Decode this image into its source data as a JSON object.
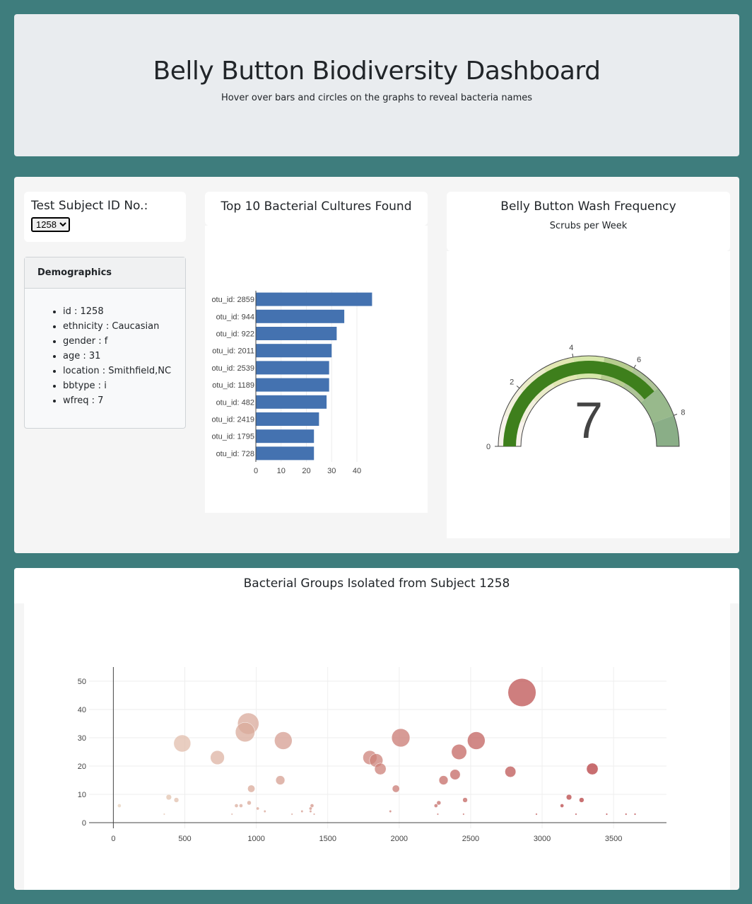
{
  "header": {
    "title": "Belly Button Biodiversity Dashboard",
    "subtitle": "Hover over bars and circles on the graphs to reveal bacteria names"
  },
  "selector": {
    "label": "Test Subject ID No.:",
    "selected": "1258"
  },
  "demographics": {
    "title": "Demographics",
    "items": [
      "id : 1258",
      "ethnicity : Caucasian",
      "gender : f",
      "age : 31",
      "location : Smithfield,NC",
      "bbtype : i",
      "wfreq : 7"
    ]
  },
  "bar_panel": {
    "title": "Top 10 Bacterial Cultures Found"
  },
  "gauge_panel": {
    "title": "Belly Button Wash Frequency",
    "subtitle": "Scrubs per Week",
    "value_text": "7"
  },
  "bubble_panel": {
    "title": "Bacterial Groups Isolated from Subject 1258"
  },
  "colors": {
    "bar": "#4472b0",
    "gauge_bar": "#3e7f1c",
    "page_bg": "#3e7d7d"
  },
  "chart_data": [
    {
      "type": "bar",
      "orientation": "horizontal",
      "categories": [
        "otu_id: 2859",
        "otu_id: 944",
        "otu_id: 922",
        "otu_id: 2011",
        "otu_id: 2539",
        "otu_id: 1189",
        "otu_id: 482",
        "otu_id: 2419",
        "otu_id: 1795",
        "otu_id: 728"
      ],
      "values": [
        46,
        35,
        32,
        30,
        29,
        29,
        28,
        25,
        23,
        23
      ],
      "xticks": [
        0,
        10,
        20,
        30,
        40
      ],
      "xlim": [
        0,
        47
      ]
    },
    {
      "type": "gauge",
      "value": 7,
      "range": [
        0,
        9
      ],
      "ticks": [
        0,
        2,
        4,
        6,
        8
      ],
      "steps": [
        {
          "range": [
            0,
            1
          ],
          "color": "#f8f3ec"
        },
        {
          "range": [
            1,
            2
          ],
          "color": "#f2f0dd"
        },
        {
          "range": [
            2,
            3
          ],
          "color": "#eaebc9"
        },
        {
          "range": [
            3,
            4
          ],
          "color": "#e2e7b3"
        },
        {
          "range": [
            4,
            5
          ],
          "color": "#d6e7aa"
        },
        {
          "range": [
            5,
            6
          ],
          "color": "#b7cd8f"
        },
        {
          "range": [
            6,
            7
          ],
          "color": "#aec497"
        },
        {
          "range": [
            7,
            8
          ],
          "color": "#98b98c"
        },
        {
          "range": [
            8,
            9
          ],
          "color": "#8aae87"
        }
      ]
    },
    {
      "type": "scatter",
      "xticks": [
        0,
        500,
        1000,
        1500,
        2000,
        2500,
        3000,
        3500
      ],
      "yticks": [
        0,
        10,
        20,
        30,
        40,
        50
      ],
      "xlim": [
        -170,
        3870
      ],
      "ylim": [
        -2,
        55
      ],
      "points": [
        {
          "x": 2859,
          "y": 46
        },
        {
          "x": 944,
          "y": 35
        },
        {
          "x": 922,
          "y": 32
        },
        {
          "x": 2011,
          "y": 30
        },
        {
          "x": 2539,
          "y": 29
        },
        {
          "x": 1189,
          "y": 29
        },
        {
          "x": 482,
          "y": 28
        },
        {
          "x": 2419,
          "y": 25
        },
        {
          "x": 1795,
          "y": 23
        },
        {
          "x": 728,
          "y": 23
        },
        {
          "x": 1839,
          "y": 22
        },
        {
          "x": 1868,
          "y": 19
        },
        {
          "x": 3351,
          "y": 19
        },
        {
          "x": 2778,
          "y": 18
        },
        {
          "x": 2391,
          "y": 17
        },
        {
          "x": 1168,
          "y": 15
        },
        {
          "x": 2310,
          "y": 15
        },
        {
          "x": 965,
          "y": 12
        },
        {
          "x": 1977,
          "y": 12
        },
        {
          "x": 3188,
          "y": 9
        },
        {
          "x": 388,
          "y": 9
        },
        {
          "x": 441,
          "y": 8
        },
        {
          "x": 2461,
          "y": 8
        },
        {
          "x": 3276,
          "y": 8
        },
        {
          "x": 2277,
          "y": 7
        },
        {
          "x": 950,
          "y": 7
        },
        {
          "x": 893,
          "y": 6
        },
        {
          "x": 861,
          "y": 6
        },
        {
          "x": 2257,
          "y": 6
        },
        {
          "x": 3139,
          "y": 6
        },
        {
          "x": 42,
          "y": 6
        },
        {
          "x": 1390,
          "y": 6
        },
        {
          "x": 1010,
          "y": 5
        },
        {
          "x": 1380,
          "y": 5
        },
        {
          "x": 1060,
          "y": 4
        },
        {
          "x": 1320,
          "y": 4
        },
        {
          "x": 1380,
          "y": 4
        },
        {
          "x": 1938,
          "y": 4
        },
        {
          "x": 1405,
          "y": 3
        },
        {
          "x": 2960,
          "y": 3
        },
        {
          "x": 3237,
          "y": 3
        },
        {
          "x": 3452,
          "y": 3
        },
        {
          "x": 3587,
          "y": 3
        },
        {
          "x": 3650,
          "y": 3
        },
        {
          "x": 356,
          "y": 3
        },
        {
          "x": 830,
          "y": 3
        },
        {
          "x": 1250,
          "y": 3
        },
        {
          "x": 2270,
          "y": 3
        },
        {
          "x": 2450,
          "y": 3
        }
      ]
    }
  ]
}
